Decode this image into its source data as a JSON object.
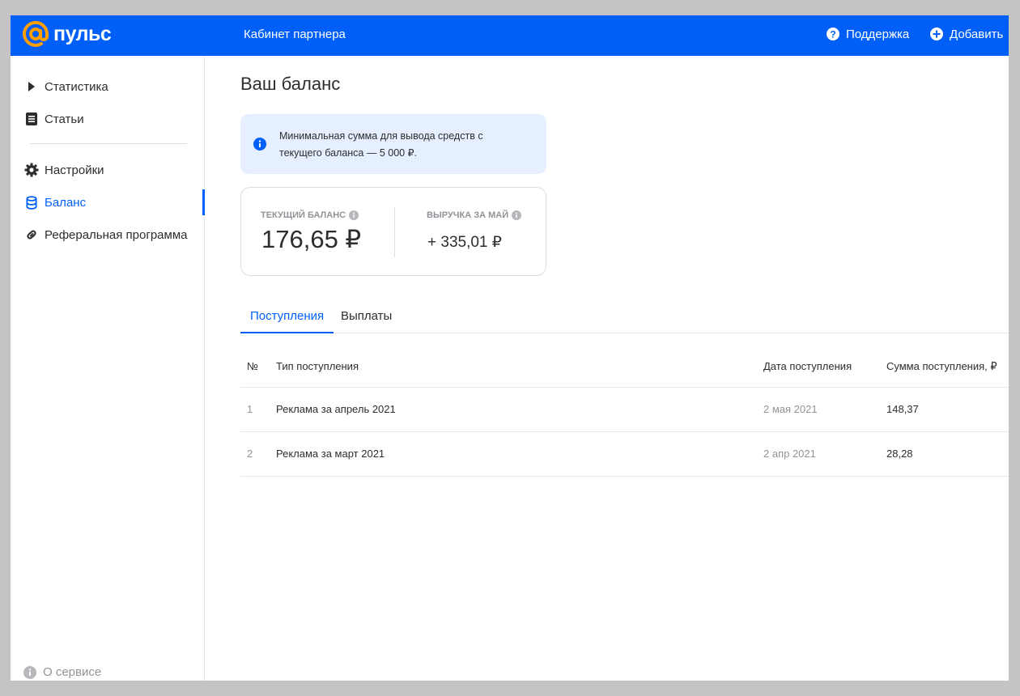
{
  "header": {
    "logo_text": "пульс",
    "cabinet_label": "Кабинет партнера",
    "support_label": "Поддержка",
    "add_label": "Добавить",
    "brand_color": "#005ff9",
    "logo_color": "#ff9e00"
  },
  "sidebar": {
    "items": [
      {
        "label": "Статистика",
        "icon": "play-triangle-icon"
      },
      {
        "label": "Статьи",
        "icon": "document-icon"
      },
      {
        "label": "Настройки",
        "icon": "gear-icon"
      },
      {
        "label": "Баланс",
        "icon": "database-icon",
        "active": true
      },
      {
        "label": "Реферальная программа",
        "icon": "link-icon"
      }
    ],
    "about_label": "О сервисе"
  },
  "main": {
    "title": "Ваш баланс",
    "info_text": "Минимальная сумма для вывода средств с текущего баланса — 5 000 ₽.",
    "balance": {
      "current_label": "ТЕКУЩИЙ БАЛАНС",
      "current_value": "176,65 ₽",
      "revenue_label": "ВЫРУЧКА ЗА МАЙ",
      "revenue_value": "+ 335,01 ₽"
    },
    "tabs": [
      {
        "label": "Поступления",
        "active": true
      },
      {
        "label": "Выплаты",
        "active": false
      }
    ],
    "table": {
      "headers": [
        "№",
        "Тип поступления",
        "Дата поступления",
        "Сумма поступления, ₽"
      ],
      "rows": [
        [
          "1",
          "Реклама за апрель 2021",
          "2 мая 2021",
          "148,37"
        ],
        [
          "2",
          "Реклама за март 2021",
          "2 апр 2021",
          "28,28"
        ]
      ]
    }
  }
}
